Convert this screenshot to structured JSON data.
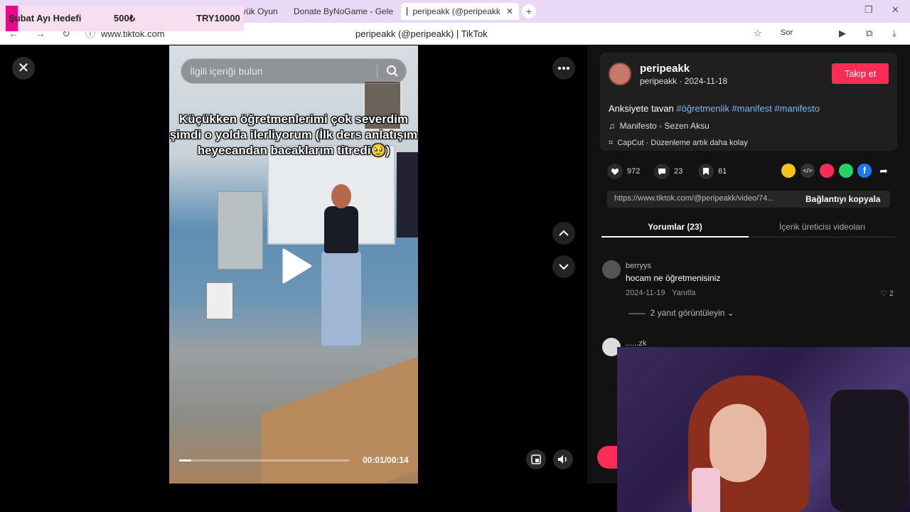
{
  "browser": {
    "tabs": [
      {
        "label": "yük Oyun"
      },
      {
        "label": "Donate ByNoGame - Gelen"
      },
      {
        "label": "peripeakk (@peripeakk"
      }
    ],
    "url": "www.tiktok.com",
    "page_title": "peripeakk (@peripeakk) | TikTok",
    "sor_label": "Sor"
  },
  "goal_overlay": {
    "label": "Şubat Ayı Hedefi",
    "current": "500₺",
    "target": "TRY10000"
  },
  "video": {
    "search_placeholder": "İlgili içeriği bulun",
    "caption": "Küçükken öğretmenlerimi çok severdim şimdi o yolda ilerliyorum (İlk ders anlatışım heyecandan bacaklarım titredi🥹)",
    "time": "00:01/00:14",
    "progress_fraction": 0.07
  },
  "post": {
    "username": "peripeakk",
    "sub": "peripeakk · 2024-11-18",
    "follow_label": "Takip et",
    "desc_text": "Anksiyete tavan ",
    "hashtags": "#öğretmenlik #manifest #manifesto",
    "music": "Manifesto - Sezen Aksu",
    "capcut": "CapCut · Düzenleme artık daha kolay",
    "likes": "972",
    "comments": "23",
    "saves": "61",
    "link": "https://www.tiktok.com/@peripeakk/video/74...",
    "copy_label": "Bağlantıyı kopyala"
  },
  "tabs": {
    "comments": "Yorumlar (23)",
    "creator_videos": "İçerik üreticisi videoları"
  },
  "comments": [
    {
      "user": "berryys",
      "text": "hocam ne öğretmenisiniz",
      "date": "2024-11-19",
      "reply": "Yanıtla",
      "likes": "2",
      "replies": "2 yanıt görüntüleyin"
    },
    {
      "user": "......zk"
    }
  ]
}
